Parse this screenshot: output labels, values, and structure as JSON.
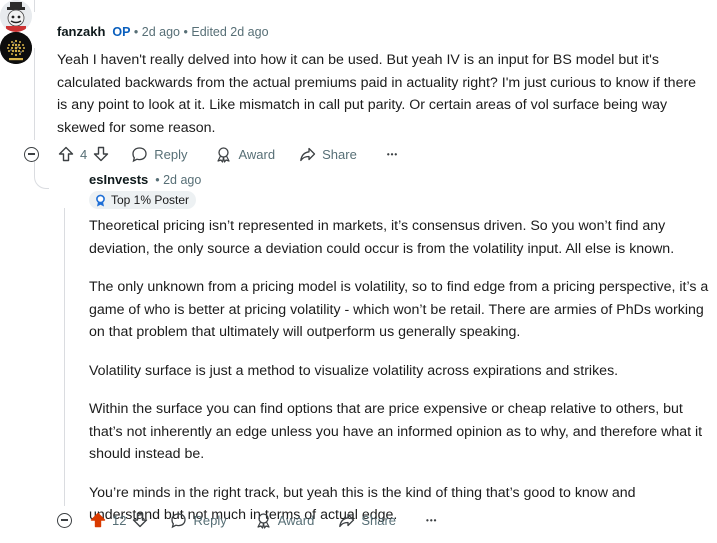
{
  "comment1": {
    "author": "fanzakh",
    "op_badge": "OP",
    "separator": "•",
    "time": "2d ago",
    "edited": "Edited 2d ago",
    "body": "Yeah I haven't really delved into how it can be used. But yeah IV is an input for BS model but it's calculated backwards from the actual premiums paid in actuality right? I'm just curious to know if there is any point to look at it. Like mismatch in call put parity. Or certain areas of vol surface being way skewed for some reason.",
    "votes": "4",
    "reply_label": "Reply",
    "award_label": "Award",
    "share_label": "Share",
    "more_label": "•••"
  },
  "comment2": {
    "author": "esInvests",
    "separator": "•",
    "time": "2d ago",
    "flair": "Top 1% Poster",
    "paragraphs": [
      "Theoretical pricing isn’t represented in markets, it’s consensus driven. So you won’t find any deviation, the only source a deviation could occur is from the volatility input. All else is known.",
      "The only unknown from a pricing model is volatility, so to find edge from a pricing perspective, it’s a game of who is better at pricing volatility - which won’t be retail. There are armies of PhDs working on that problem that ultimately will outperform us generally speaking.",
      "Volatility surface is just a method to visualize volatility across expirations and strikes.",
      "Within the surface you can find options that are price expensive or cheap relative to others, but that’s not inherently an edge unless you have an informed opinion as to why, and therefore what it should instead be.",
      "You’re minds in the right track, but yeah this is the kind of thing that’s good to know and understand but not much in terms of actual edge."
    ],
    "votes": "12",
    "reply_label": "Reply",
    "award_label": "Award",
    "share_label": "Share",
    "more_label": "•••"
  },
  "colors": {
    "upvoted": "#d93a00",
    "meta": "#576f76",
    "op": "#0a5fbd"
  }
}
